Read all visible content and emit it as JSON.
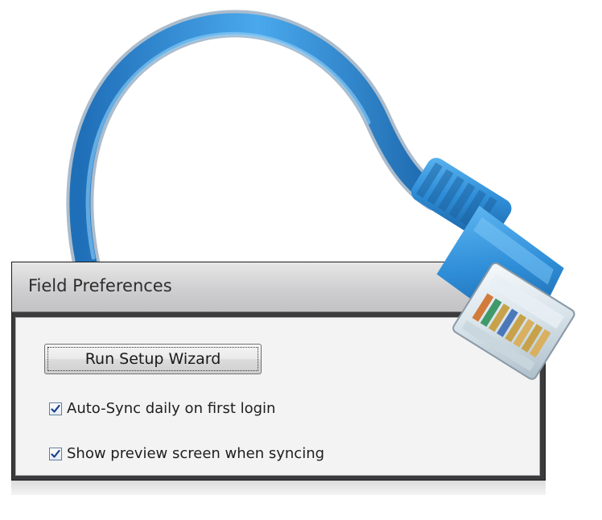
{
  "dialog": {
    "title": "Field Preferences",
    "wizard_button_label": "Run Setup Wizard",
    "options": [
      {
        "label": "Auto-Sync daily on first login",
        "checked": true
      },
      {
        "label": "Show preview screen when syncing",
        "checked": true
      }
    ]
  },
  "artwork": {
    "subject": "blue-ethernet-cable",
    "cable_color": "#2f8fd8",
    "connector_color": "#2a7fc8"
  },
  "colors": {
    "title_bar": "#cfcfd1",
    "frame": "#3b3b3d",
    "body": "#f3f3f3",
    "checkbox_border": "#5e7e9e"
  }
}
